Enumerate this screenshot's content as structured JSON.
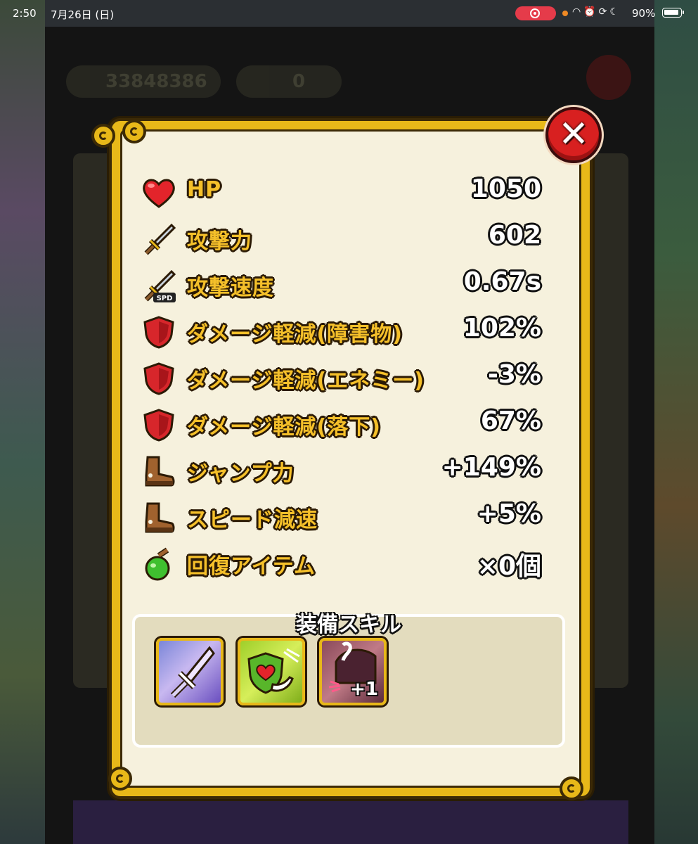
{
  "status_bar": {
    "time": "2:50",
    "date": "7月26日 (日)",
    "battery_percent": "90%",
    "recording": true
  },
  "background_hud": {
    "coins": "33848386",
    "gems": "0"
  },
  "modal": {
    "close_label": "✕",
    "stats": [
      {
        "icon": "heart-icon",
        "label": "HP",
        "value": "1050"
      },
      {
        "icon": "sword-icon",
        "label": "攻撃力",
        "value": "602"
      },
      {
        "icon": "sword-speed-icon",
        "label": "攻撃速度",
        "value": "0.67s",
        "icon_badge": "SPD"
      },
      {
        "icon": "shield-icon",
        "label": "ダメージ軽減(障害物)",
        "value": "102%"
      },
      {
        "icon": "shield-icon",
        "label": "ダメージ軽減(エネミー)",
        "value": "-3%"
      },
      {
        "icon": "shield-icon",
        "label": "ダメージ軽減(落下)",
        "value": "67%"
      },
      {
        "icon": "boot-icon",
        "label": "ジャンプ力",
        "value": "+149%"
      },
      {
        "icon": "boot-icon",
        "label": "スピード減速",
        "value": "+5%"
      },
      {
        "icon": "potion-icon",
        "label": "回復アイテム",
        "value": "×0個"
      }
    ],
    "skills": {
      "title": "装備スキル",
      "slots": [
        {
          "icon": "crystal-sword-skill-icon"
        },
        {
          "icon": "heart-shield-skill-icon"
        },
        {
          "icon": "bear-claw-skill-icon",
          "badge": "+1"
        }
      ]
    }
  },
  "colors": {
    "frame_gold": "#e8b819",
    "panel_cream": "#f6f1dd",
    "label_gold": "#f5c02a",
    "close_red": "#d82020"
  }
}
